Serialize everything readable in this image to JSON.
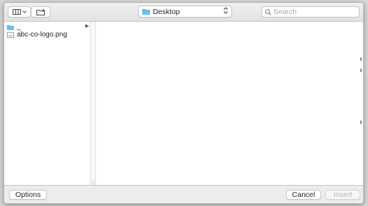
{
  "toolbar": {
    "view_icon": "column-view-icon",
    "view_menu_icon": "chevron-down-icon",
    "new_folder_icon": "new-folder-icon",
    "location": {
      "label": "Desktop",
      "icon": "folder-icon",
      "stepper_icon": "up-down-chevron-icon"
    },
    "search": {
      "icon": "search-icon",
      "placeholder": "Search",
      "value": ""
    }
  },
  "browser": {
    "column1": {
      "items": [
        {
          "name": "_",
          "type": "folder",
          "icon": "folder-icon",
          "has_children": true
        },
        {
          "name": "abc-co-logo.png",
          "type": "image",
          "icon": "image-file-icon",
          "has_children": false
        }
      ]
    }
  },
  "footer": {
    "options_label": "Options",
    "cancel_label": "Cancel",
    "insert_label": "Insert",
    "insert_enabled": false
  },
  "colors": {
    "folder": "#5aaee9",
    "dialog_bg": "#ececec",
    "content_bg": "#ffffff",
    "disabled_text": "#b6b6b6"
  }
}
